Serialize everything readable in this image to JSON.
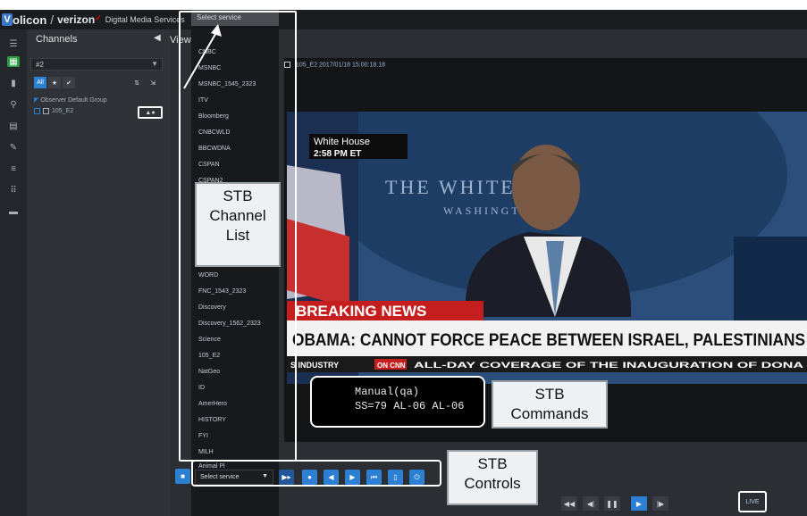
{
  "brand": {
    "logo_initial": "V",
    "logo_rest": "olicon",
    "partner": "verizon",
    "product": "Digital Media Services"
  },
  "channels_panel": {
    "title": "Channels",
    "search_value": "#2",
    "tool_all": "All",
    "group": "Observer Default Group",
    "item": "105_E2"
  },
  "view_label": "View",
  "dropdown": {
    "header": "Select service",
    "items": [
      "CNBC",
      "MSNBC",
      "MSNBC_1545_2323",
      "ITV",
      "Bloomberg",
      "CNBCWLD",
      "BBCWDNA",
      "CSPAN",
      "CSPAN2",
      "WORD",
      "FNC_1543_2323",
      "Discovery",
      "Discovery_1562_2323",
      "Science",
      "105_E2",
      "NatGeo",
      "ID",
      "AmerHero",
      "HISTORY",
      "FYI",
      "MILH",
      "Animal Pl"
    ]
  },
  "video": {
    "stream_title": "105_E2  2017/01/18 15:00:18.18",
    "wh_line1": "White House",
    "wh_line2": "2:58 PM ET",
    "backdrop_line1": "THE WHITE",
    "backdrop_line2": "WASHINGTO",
    "breaking": "BREAKING NEWS",
    "headline": "OBAMA: CANNOT FORCE PEACE BETWEEN ISRAEL, PALESTINIANS",
    "ticker_left": "S INDUSTRY",
    "ticker_badge": "ON CNN",
    "ticker_right": "ALL-DAY COVERAGE OF THE INAUGURATION OF DONA"
  },
  "commands_overlay": {
    "line1": "Manual(qa)",
    "line2": "SS=79 AL-06 AL-06"
  },
  "callouts": {
    "channel_list": [
      "STB",
      "Channel",
      "List"
    ],
    "commands": [
      "STB",
      "Commands"
    ],
    "controls": [
      "STB",
      "Controls"
    ]
  },
  "controls": {
    "select_label": "Select service"
  },
  "player": {
    "live_label": "LIVE"
  }
}
